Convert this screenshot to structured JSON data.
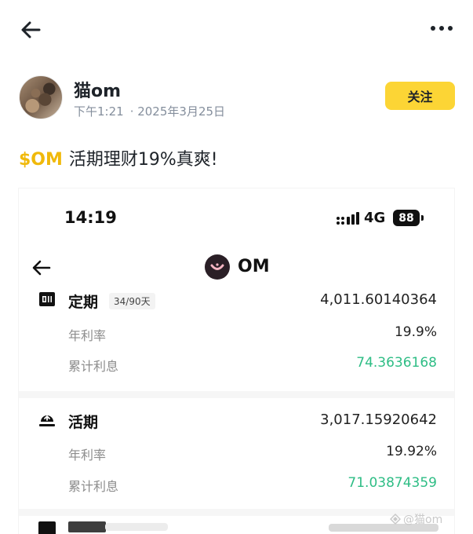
{
  "header": {
    "back_icon": "arrow-left-icon",
    "more_icon": "more-dots-icon"
  },
  "author": {
    "name": "猫om",
    "time": "下午1:21",
    "date": "· 2025年3月25日",
    "follow_label": "关注"
  },
  "post": {
    "ticker": "$OM",
    "text": "活期理财19%真爽!"
  },
  "screenshot": {
    "status_time": "14:19",
    "network": "4G",
    "battery": "88",
    "coin": "OM",
    "fixed": {
      "title": "定期",
      "tag": "34/90天",
      "total": "4,011.60140364",
      "rate_label": "年利率",
      "rate": "19.9%",
      "interest_label": "累计利息",
      "interest": "74.3636168"
    },
    "flexible": {
      "title": "活期",
      "total": "3,017.15920642",
      "rate_label": "年利率",
      "rate": "19.92%",
      "interest_label": "累计利息",
      "interest": "71.03874359"
    }
  },
  "watermark": "@猫om",
  "colors": {
    "accent": "#fcd535",
    "ticker": "#f0b90b",
    "positive": "#2ebd85",
    "muted": "#848e9c"
  }
}
